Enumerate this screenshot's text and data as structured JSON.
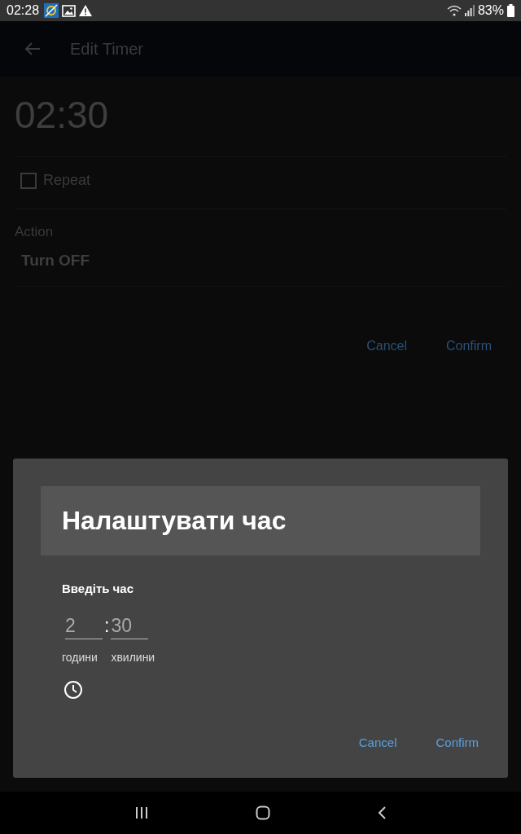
{
  "status_bar": {
    "time": "02:28",
    "battery": "83%"
  },
  "app_bar": {
    "title": "Edit Timer"
  },
  "timer": {
    "time": "02:30",
    "repeat": {
      "label": "Repeat",
      "checked": false
    },
    "action": {
      "label": "Action",
      "value": "Turn OFF"
    },
    "buttons": [
      "Cancel",
      "Confirm"
    ]
  },
  "dialog": {
    "title": "Налаштувати час",
    "prompt": "Введіть час",
    "hours": {
      "value": "2",
      "label": "години"
    },
    "separator": ":",
    "minutes": {
      "value": "30",
      "label": "хвилини"
    },
    "buttons": [
      "Cancel",
      "Confirm"
    ]
  }
}
